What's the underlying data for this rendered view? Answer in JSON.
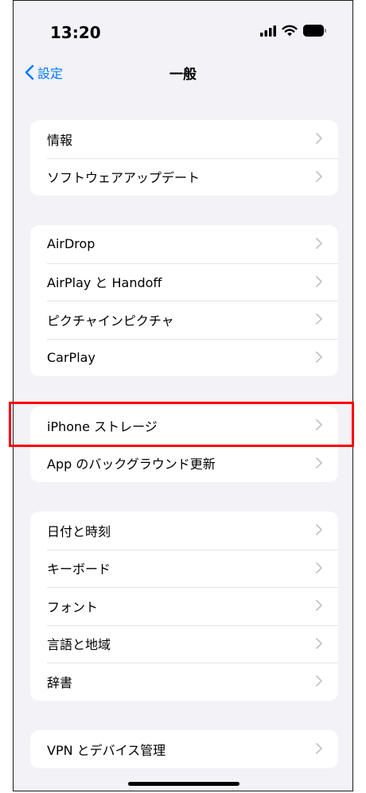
{
  "status_bar": {
    "time": "13:20"
  },
  "nav": {
    "back_label": "設定",
    "title": "一般"
  },
  "groups": [
    {
      "items": [
        {
          "label": "情報"
        },
        {
          "label": "ソフトウェアアップデート"
        }
      ]
    },
    {
      "items": [
        {
          "label": "AirDrop"
        },
        {
          "label": "AirPlay と Handoff"
        },
        {
          "label": "ピクチャインピクチャ"
        },
        {
          "label": "CarPlay"
        }
      ]
    },
    {
      "items": [
        {
          "label": "iPhone ストレージ"
        },
        {
          "label": "App のバックグラウンド更新"
        }
      ]
    },
    {
      "items": [
        {
          "label": "日付と時刻"
        },
        {
          "label": "キーボード"
        },
        {
          "label": "フォント"
        },
        {
          "label": "言語と地域"
        },
        {
          "label": "辞書"
        }
      ]
    },
    {
      "items": [
        {
          "label": "VPN とデバイス管理"
        }
      ]
    }
  ],
  "colors": {
    "accent": "#007aff",
    "highlight": "#ff0000",
    "background": "#f2f2f7"
  }
}
